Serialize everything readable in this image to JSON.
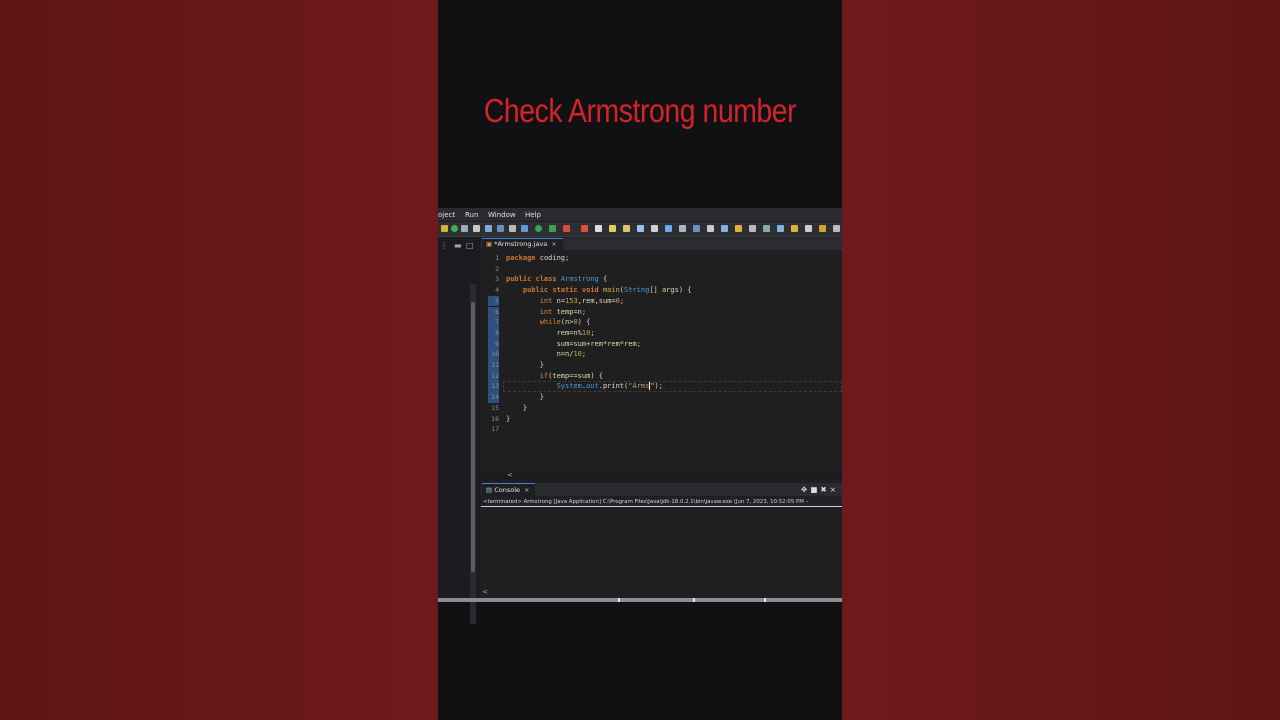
{
  "video": {
    "title": "Check Armstrong number"
  },
  "menu": [
    "oject",
    "Run",
    "Window",
    "Help"
  ],
  "editor": {
    "tab_label": "*Armstrong.java",
    "tab_close": "×",
    "lines": [
      {
        "n": "1",
        "code": "package coding;"
      },
      {
        "n": "2",
        "code": ""
      },
      {
        "n": "3",
        "code": "public class Armstrong {"
      },
      {
        "n": "4",
        "code": "    public static void main(String[] args) {"
      },
      {
        "n": "5",
        "code": "        int n=153,rem,sum=0;"
      },
      {
        "n": "6",
        "code": "        int temp=n;"
      },
      {
        "n": "7",
        "code": "        while(n>0) {"
      },
      {
        "n": "8",
        "code": "            rem=n%10;"
      },
      {
        "n": "9",
        "code": "            sum=sum+rem*rem*rem;"
      },
      {
        "n": "10",
        "code": "            n=n/10;"
      },
      {
        "n": "11",
        "code": "        }"
      },
      {
        "n": "12",
        "code": "        if(temp==sum) {"
      },
      {
        "n": "13",
        "code": "            System.out.print(\"Arms\");"
      },
      {
        "n": "14",
        "code": "        }"
      },
      {
        "n": "15",
        "code": "    }"
      },
      {
        "n": "16",
        "code": "}"
      },
      {
        "n": "17",
        "code": ""
      }
    ],
    "scroll_left": "<"
  },
  "console": {
    "tab_label": "Console",
    "tab_close": "×",
    "status": "<terminated> Armstrong [Java Application] C:\\Program Files\\Java\\jdk-18.0.2.1\\bin\\javaw.exe  (Jun 7, 2023, 10:52:05 PM –",
    "scroll_left": "<"
  },
  "colors": {
    "title": "#d4232a",
    "background": "#6b1719",
    "keyword": "#cc7832",
    "class": "#4d9de0"
  }
}
